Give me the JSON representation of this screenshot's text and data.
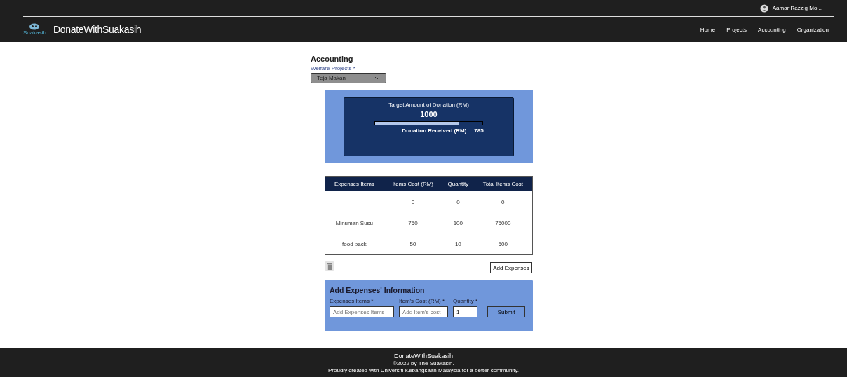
{
  "header": {
    "user": "Aamar Razzig Mo...",
    "logo_caption": "Suakasih",
    "brand": "DonateWithSuakasih",
    "nav": [
      {
        "label": "Home"
      },
      {
        "label": "Projects"
      },
      {
        "label": "Accounting"
      },
      {
        "label": "Organization"
      }
    ]
  },
  "page": {
    "title": "Accounting",
    "project_label": "Welfare Projects *",
    "project_value": "Teja Makan"
  },
  "donation": {
    "title": "Target Amount of Donation (RM)",
    "target": "1000",
    "level": 0.785,
    "received_label": "Donation Received (RM) :",
    "received": "785"
  },
  "table": {
    "columns": [
      "Expenses Items",
      "Items Cost (RM)",
      "Quantity",
      "Total Items Cost"
    ],
    "rows": [
      [
        "",
        "0",
        "0",
        "0"
      ],
      [
        "Minuman Susu",
        "750",
        "100",
        "75000"
      ],
      [
        "food pack",
        "50",
        "10",
        "500"
      ]
    ]
  },
  "add_button": "Add Expenses",
  "form": {
    "title": "Add Expenses' Information",
    "fields": [
      {
        "label": "Expenses Items *",
        "placeholder": "Add Expenses Items"
      },
      {
        "label": "Item's Cost (RM) *",
        "placeholder": "Add Item's cost"
      },
      {
        "label": "Quantity *",
        "value": "1"
      }
    ],
    "submit": "Submit"
  },
  "footer": {
    "brand": "DonateWithSuakasih",
    "copyright": "©2022 by The Suakasih.",
    "note": "Proudly created with Universiti Kebangsaan Malaysia for a better community."
  }
}
